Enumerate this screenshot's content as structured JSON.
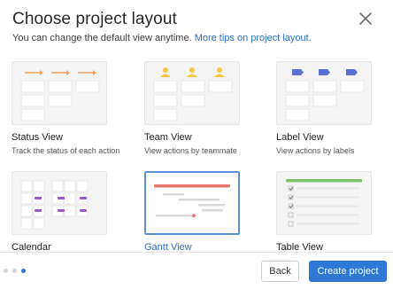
{
  "dialog": {
    "title": "Choose project layout",
    "subtitle_text": "You can change the default view anytime.",
    "subtitle_link": "More tips on project layout."
  },
  "layouts": [
    {
      "title": "Status View",
      "description": "Track the status of each action"
    },
    {
      "title": "Team View",
      "description": "View actions by teammate"
    },
    {
      "title": "Label View",
      "description": "View actions by labels"
    },
    {
      "title": "Calendar",
      "description": ""
    },
    {
      "title": "Gantt View",
      "description": "",
      "selected": true
    },
    {
      "title": "Table View",
      "description": ""
    }
  ],
  "footer": {
    "back_label": "Back",
    "create_label": "Create project",
    "pager": {
      "total": 3,
      "current": 3
    }
  },
  "colors": {
    "accent": "#2f78d6",
    "status_arrow": "#f2a25a",
    "team_avatar": "#f5c543",
    "label_tag": "#5b6fd6",
    "calendar_event": "#9b59d0",
    "gantt_bar": "#e8786f",
    "table_header": "#7cc36a"
  }
}
